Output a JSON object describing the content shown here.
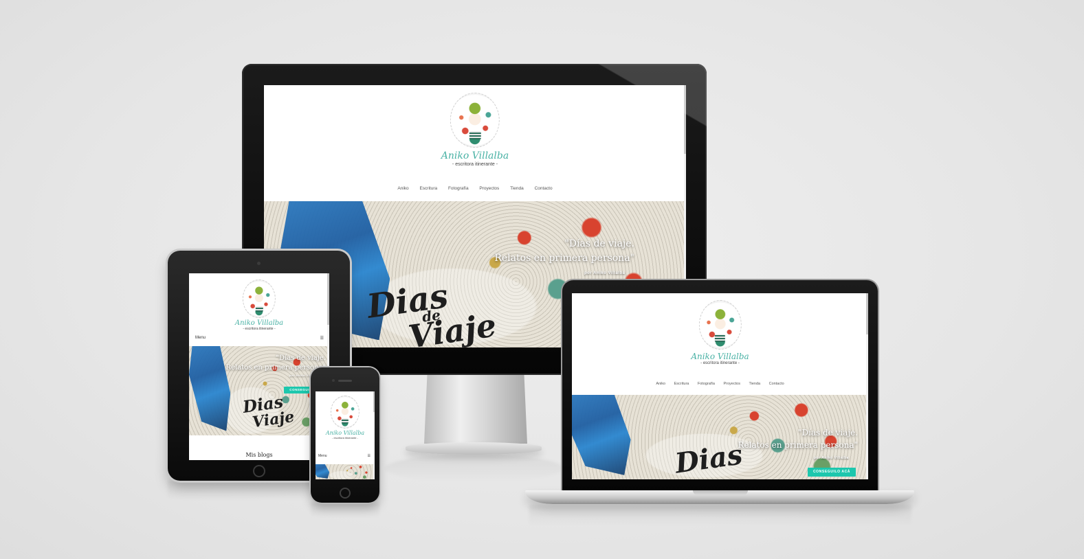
{
  "site": {
    "brand": "Aniko Villalba",
    "tagline": "- escritora itinerante -",
    "nav": [
      "Aniko",
      "Escritura",
      "Fotografía",
      "Proyectos",
      "Tienda",
      "Contacto"
    ],
    "hero": {
      "quote_line1": "\"Días de viaje.",
      "quote_line2": "Relatos en primera persona\"",
      "byline": "por Aniko Villalba",
      "cta": "CONSEGUILO ACÁ",
      "scribble_top": "Dias",
      "scribble_mid": "de",
      "scribble_bottom": "Viaje"
    },
    "mobile_menu_label": "Menu",
    "tablet_menu_label": "Menu",
    "tablet_section_title": "Mis blogs"
  },
  "colors": {
    "accent": "#48b1a4",
    "cta": "#1dc7ad",
    "background": "#e8e8e8",
    "device_bezel": "#0a0a0a"
  },
  "icons": {
    "menu": "hamburger-icon",
    "logo": "illustrated-girl-logo"
  }
}
